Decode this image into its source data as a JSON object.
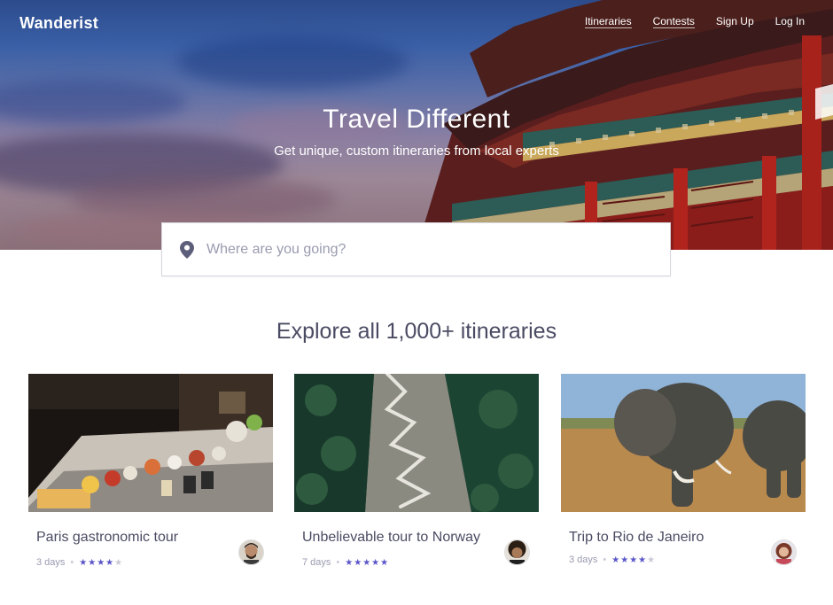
{
  "brand": {
    "logo": "Wanderist"
  },
  "nav": [
    {
      "label": "Itineraries"
    },
    {
      "label": "Contests"
    },
    {
      "label": "Sign Up"
    },
    {
      "label": "Log In"
    }
  ],
  "hero": {
    "title": "Travel Different",
    "subtitle": "Get unique, custom itineraries from local experts"
  },
  "search": {
    "placeholder": "Where are you going?",
    "icon": "map-pin-icon"
  },
  "section": {
    "title": "Explore all 1,000+ itineraries"
  },
  "cards": [
    {
      "title": "Paris gastronomic tour",
      "duration": "3 days",
      "rating": 4,
      "max_rating": 5,
      "stars_on": "★★★★",
      "stars_off": "★"
    },
    {
      "title": "Unbelievable tour to Norway",
      "duration": "7 days",
      "rating": 5,
      "max_rating": 5,
      "stars_on": "★★★★★",
      "stars_off": ""
    },
    {
      "title": "Trip to Rio de Janeiro",
      "duration": "3 days",
      "rating": 4,
      "max_rating": 5,
      "stars_on": "★★★★",
      "stars_off": "★"
    }
  ],
  "colors": {
    "accent": "#5a55c9",
    "text": "#4a4b63",
    "muted": "#9a9bb0"
  }
}
